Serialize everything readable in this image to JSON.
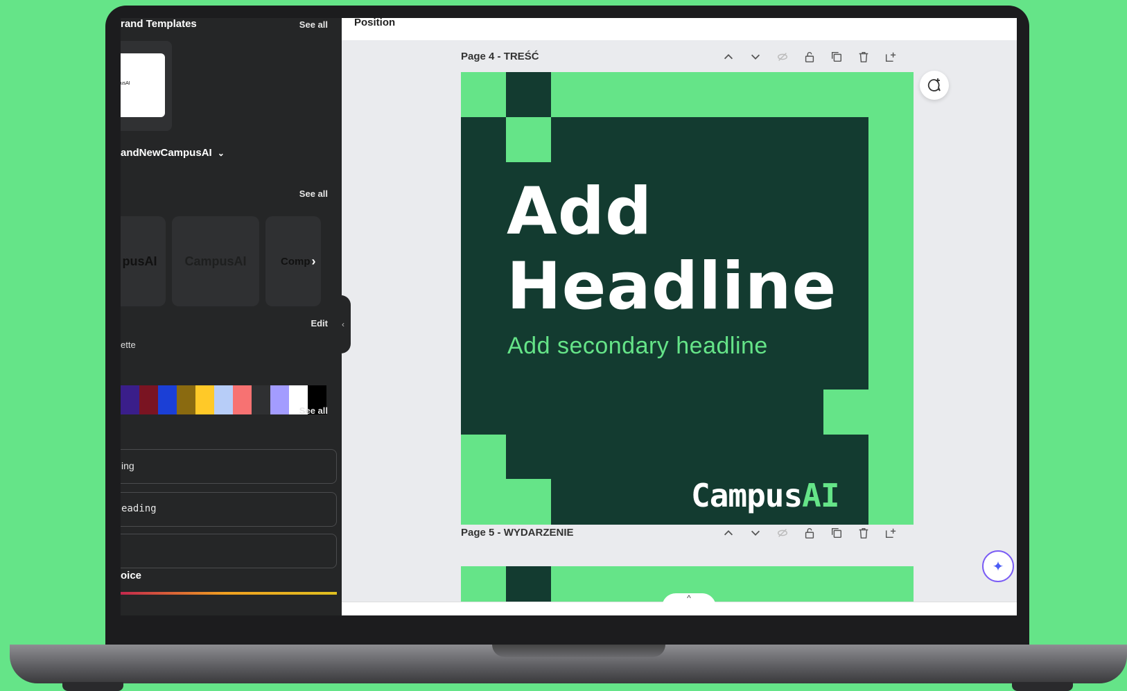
{
  "colors": {
    "background": "#65e488",
    "panel": "#252627",
    "canvas_dark": "#133b30",
    "canvas_green": "#65e488",
    "accent_purple": "#7a5cf5"
  },
  "sidebar": {
    "brand_templates": {
      "title": "rand Templates",
      "see_all": "See all",
      "thumb_text": "mpusAI"
    },
    "brand_kit": {
      "name": "andNewCampusAI"
    },
    "logos": {
      "see_all": "See all",
      "items": [
        "pusAI",
        "CampusAI",
        "Comp"
      ]
    },
    "palette": {
      "edit": "Edit",
      "title": "ette",
      "colors": [
        "#3a1e8a",
        "#7a1422",
        "#1b3fd6",
        "#8a6a10",
        "#ffc928",
        "#b7cdf8",
        "#f77272",
        "#2f3032",
        "#a39cff",
        "#ffffff",
        "#000000"
      ]
    },
    "fonts": {
      "see_all": "See all",
      "items": [
        "ing",
        "eading",
        ""
      ]
    },
    "voice": {
      "title": "oice"
    }
  },
  "editor": {
    "toolbar": {
      "position_label": "Position"
    },
    "pages": [
      {
        "label": "Page 4 - TREŚĆ"
      },
      {
        "label": "Page 5 - WYDARZENIE"
      }
    ],
    "page_tools": [
      "chevron-up-icon",
      "chevron-down-icon",
      "hide-icon",
      "lock-icon",
      "duplicate-icon",
      "delete-icon",
      "add-page-icon"
    ]
  },
  "design": {
    "headline_line1": "Add",
    "headline_line2": "Headline",
    "secondary_headline": "Add secondary headline",
    "brand_word": "Campus",
    "brand_suffix": "AI"
  },
  "bottom_tab": {
    "label": "^"
  }
}
